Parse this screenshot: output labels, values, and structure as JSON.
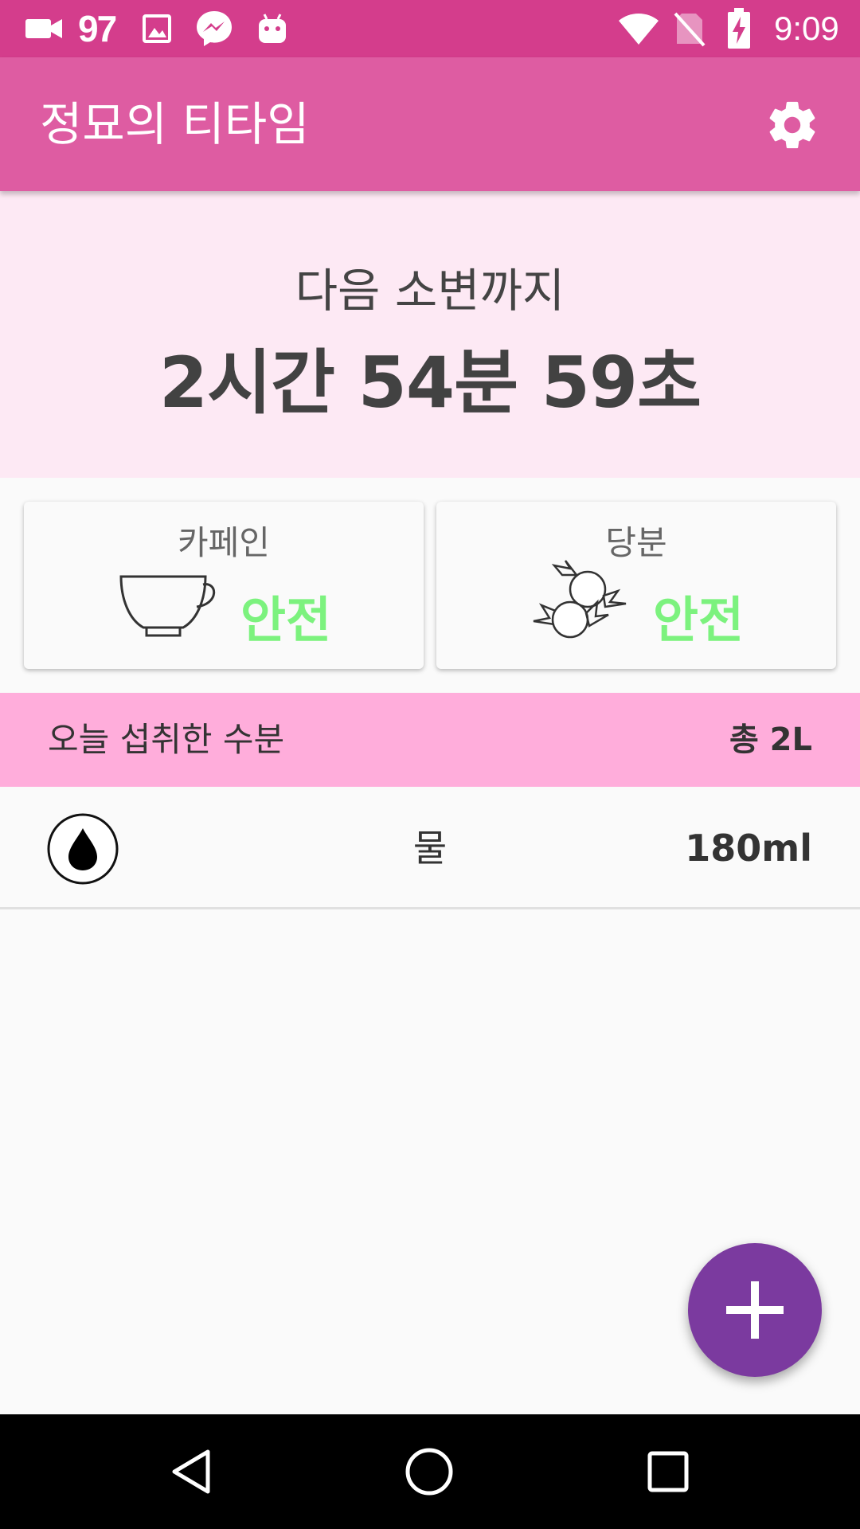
{
  "status_bar": {
    "notification_count": "97",
    "time": "9:09",
    "icons": [
      "video-camera-icon",
      "image-icon",
      "messenger-icon",
      "android-icon",
      "wifi-icon",
      "no-sim-icon",
      "battery-charging-icon"
    ]
  },
  "app_bar": {
    "title": "정묘의 티타임",
    "settings_icon": "gear-icon"
  },
  "timer": {
    "label": "다음 소변까지",
    "value": "2시간 54분 59초"
  },
  "cards": [
    {
      "title": "카페인",
      "icon": "teacup-icon",
      "state": "안전",
      "state_color": "#7cf27e"
    },
    {
      "title": "당분",
      "icon": "candy-icon",
      "state": "안전",
      "state_color": "#7cf27e"
    }
  ],
  "water_section": {
    "label": "오늘 섭취한 수분",
    "total": "총 2L"
  },
  "drinks": [
    {
      "icon": "water-drop-icon",
      "name": "물",
      "amount": "180ml"
    }
  ],
  "fab": {
    "icon": "plus-icon"
  },
  "nav_bar": {
    "icons": [
      "back-icon",
      "home-icon",
      "recents-icon"
    ]
  },
  "colors": {
    "status_bar": "#d43d8c",
    "app_bar": "#de5ca2",
    "timer_background": "#fde9f4",
    "water_header": "#ffaddb",
    "fab": "#7b3a9f",
    "safe_green": "#7cf27e"
  }
}
